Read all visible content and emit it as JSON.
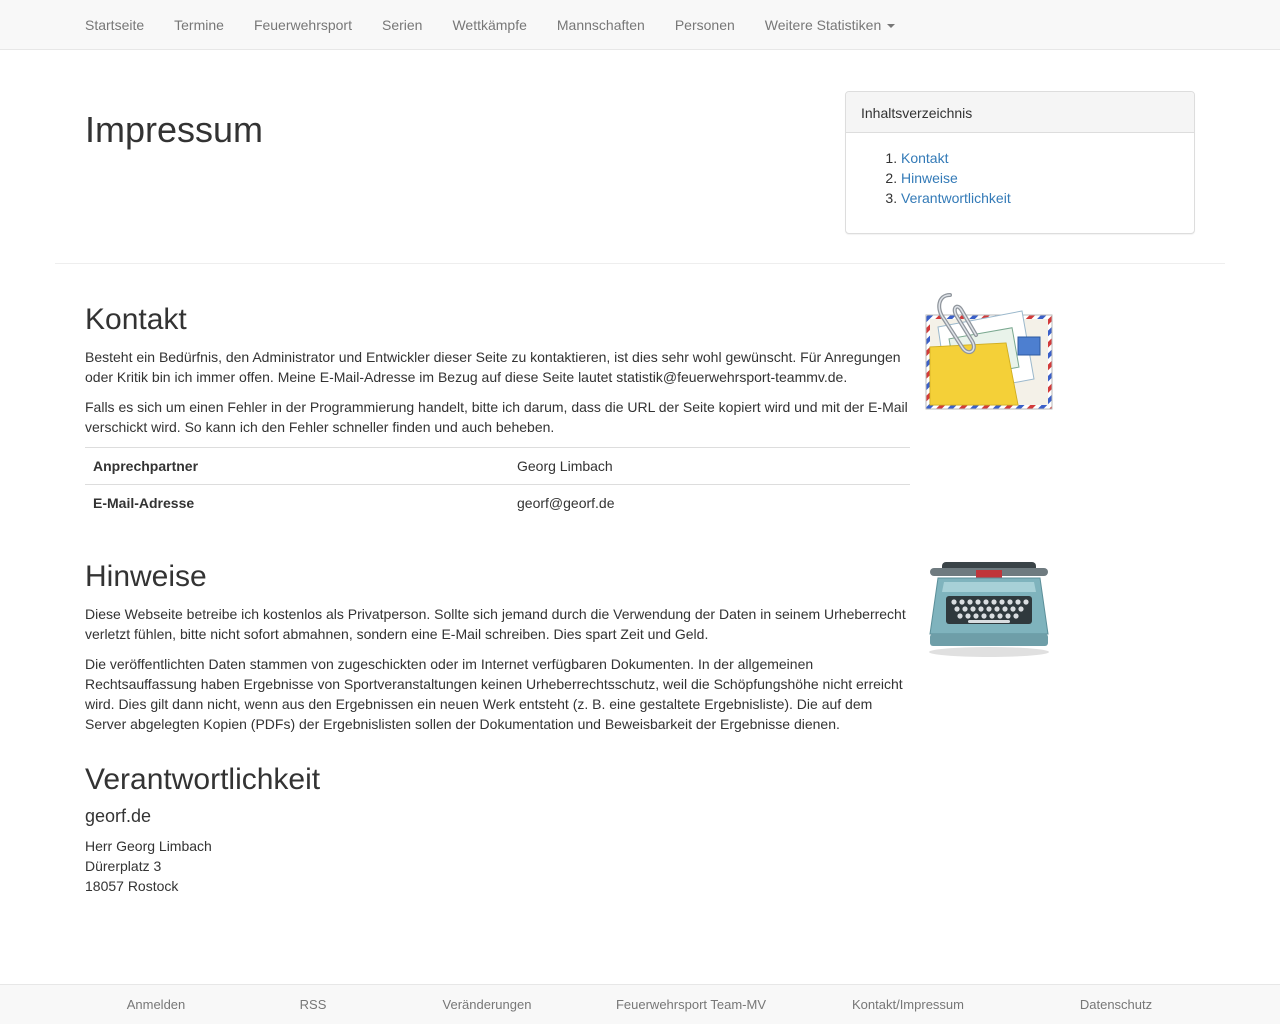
{
  "nav": {
    "items": [
      "Startseite",
      "Termine",
      "Feuerwehrsport",
      "Serien",
      "Wettkämpfe",
      "Mannschaften",
      "Personen"
    ],
    "dropdown_label": "Weitere Statistiken"
  },
  "page": {
    "title": "Impressum"
  },
  "toc": {
    "heading": "Inhaltsverzeichnis",
    "items": [
      "Kontakt",
      "Hinweise",
      "Verantwortlichkeit"
    ]
  },
  "kontakt": {
    "title": "Kontakt",
    "p1": "Besteht ein Bedürfnis, den Administrator und Entwickler dieser Seite zu kontaktieren, ist dies sehr wohl gewünscht. Für Anregungen oder Kritik bin ich immer offen. Meine E-Mail-Adresse im Bezug auf diese Seite lautet statistik@feuerwehrsport-teammv.de.",
    "p2": "Falls es sich um einen Fehler in der Programmierung handelt, bitte ich darum, dass die URL der Seite kopiert wird und mit der E-Mail verschickt wird. So kann ich den Fehler schneller finden und auch beheben.",
    "table": [
      {
        "key": "Anprechpartner",
        "value": "Georg Limbach"
      },
      {
        "key": "E-Mail-Adresse",
        "value": "georf@georf.de"
      }
    ],
    "icon": "mail-icon"
  },
  "hinweise": {
    "title": "Hinweise",
    "p1": "Diese Webseite betreibe ich kostenlos als Privatperson. Sollte sich jemand durch die Verwendung der Daten in seinem Urheberrecht verletzt fühlen, bitte nicht sofort abmahnen, sondern eine E-Mail schreiben. Dies spart Zeit und Geld.",
    "p2": "Die veröffentlichten Daten stammen von zugeschickten oder im Internet verfügbaren Dokumenten. In der allgemeinen Rechtsauffassung haben Ergebnisse von Sportveranstaltungen keinen Urheberrechtsschutz, weil die Schöpfungshöhe nicht erreicht wird. Dies gilt dann nicht, wenn aus den Ergebnissen ein neuen Werk entsteht (z. B. eine gestaltete Ergebnisliste). Die auf dem Server abgelegten Kopien (PDFs) der Ergebnislisten sollen der Dokumentation und Beweisbarkeit der Ergebnisse dienen.",
    "icon": "typewriter-icon"
  },
  "verantwortlichkeit": {
    "title": "Verantwortlichkeit",
    "subtitle": "georf.de",
    "address": [
      "Herr Georg Limbach",
      "Dürerplatz 3",
      "18057 Rostock"
    ]
  },
  "footer": {
    "links": [
      "Anmelden",
      "RSS",
      "Veränderungen",
      "Feuerwehrsport Team-MV",
      "Kontakt/Impressum",
      "Datenschutz"
    ]
  },
  "colors": {
    "navbar_bg": "#f8f8f8",
    "link": "#337ab7",
    "nav_text": "#777777",
    "text": "#333333"
  }
}
